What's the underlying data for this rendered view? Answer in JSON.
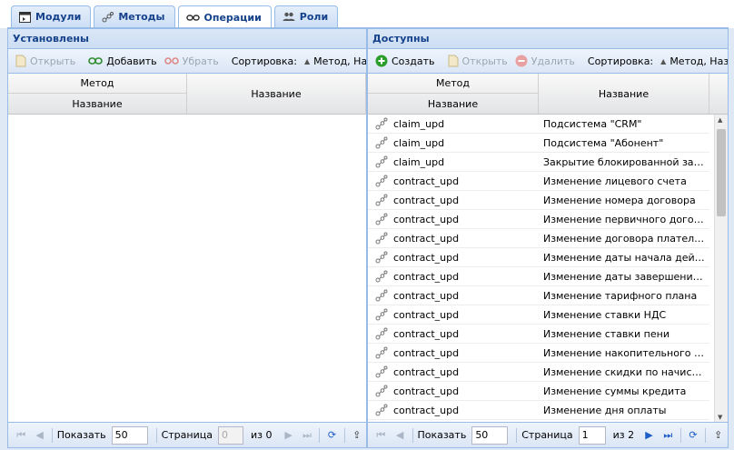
{
  "tabs": [
    {
      "label": "Модули",
      "icon": "module-icon",
      "active": false
    },
    {
      "label": "Методы",
      "icon": "method-icon",
      "active": false
    },
    {
      "label": "Операции",
      "icon": "link-icon",
      "active": true
    },
    {
      "label": "Роли",
      "icon": "users-icon",
      "active": false
    }
  ],
  "left": {
    "title": "Установлены",
    "toolbar": {
      "open": "Открыть",
      "add": "Добавить",
      "remove": "Убрать",
      "sort_label": "Сортировка:",
      "sort_value": "Метод, Назв"
    },
    "columns": {
      "method": "Метод",
      "name_sub": "Название",
      "name": "Название"
    },
    "paging": {
      "show_label": "Показать",
      "page_size": "50",
      "page_label": "Страница",
      "page": "0",
      "of": "из 0"
    }
  },
  "right": {
    "title": "Доступны",
    "toolbar": {
      "create": "Создать",
      "open": "Открыть",
      "delete": "Удалить",
      "sort_label": "Сортировка:",
      "sort_value": "Метод, Назва"
    },
    "columns": {
      "method": "Метод",
      "name_sub": "Название",
      "name": "Название"
    },
    "rows": [
      {
        "method": "claim_upd",
        "name": "Подсистема \"CRM\""
      },
      {
        "method": "claim_upd",
        "name": "Подсистема \"Абонент\""
      },
      {
        "method": "claim_upd",
        "name": "Закрытие блокированной заявки"
      },
      {
        "method": "contract_upd",
        "name": "Изменение лицевого счета"
      },
      {
        "method": "contract_upd",
        "name": "Изменение номера договора"
      },
      {
        "method": "contract_upd",
        "name": "Изменение первичного договора"
      },
      {
        "method": "contract_upd",
        "name": "Изменение договора плательщика"
      },
      {
        "method": "contract_upd",
        "name": "Изменение даты начала действия"
      },
      {
        "method": "contract_upd",
        "name": "Изменение даты завершения де..."
      },
      {
        "method": "contract_upd",
        "name": "Изменение тарифного плана"
      },
      {
        "method": "contract_upd",
        "name": "Изменение ставки НДС"
      },
      {
        "method": "contract_upd",
        "name": "Изменение ставки пени"
      },
      {
        "method": "contract_upd",
        "name": "Изменение накопительного лим..."
      },
      {
        "method": "contract_upd",
        "name": "Изменение скидки по начислени..."
      },
      {
        "method": "contract_upd",
        "name": "Изменение суммы кредита"
      },
      {
        "method": "contract_upd",
        "name": "Изменение дня оплаты"
      }
    ],
    "paging": {
      "show_label": "Показать",
      "page_size": "50",
      "page_label": "Страница",
      "page": "1",
      "of": "из 2"
    }
  },
  "colors": {
    "accent": "#15428b",
    "border": "#99bbe8",
    "create_green": "#2a9d2a",
    "delete_red": "#d9534f"
  }
}
